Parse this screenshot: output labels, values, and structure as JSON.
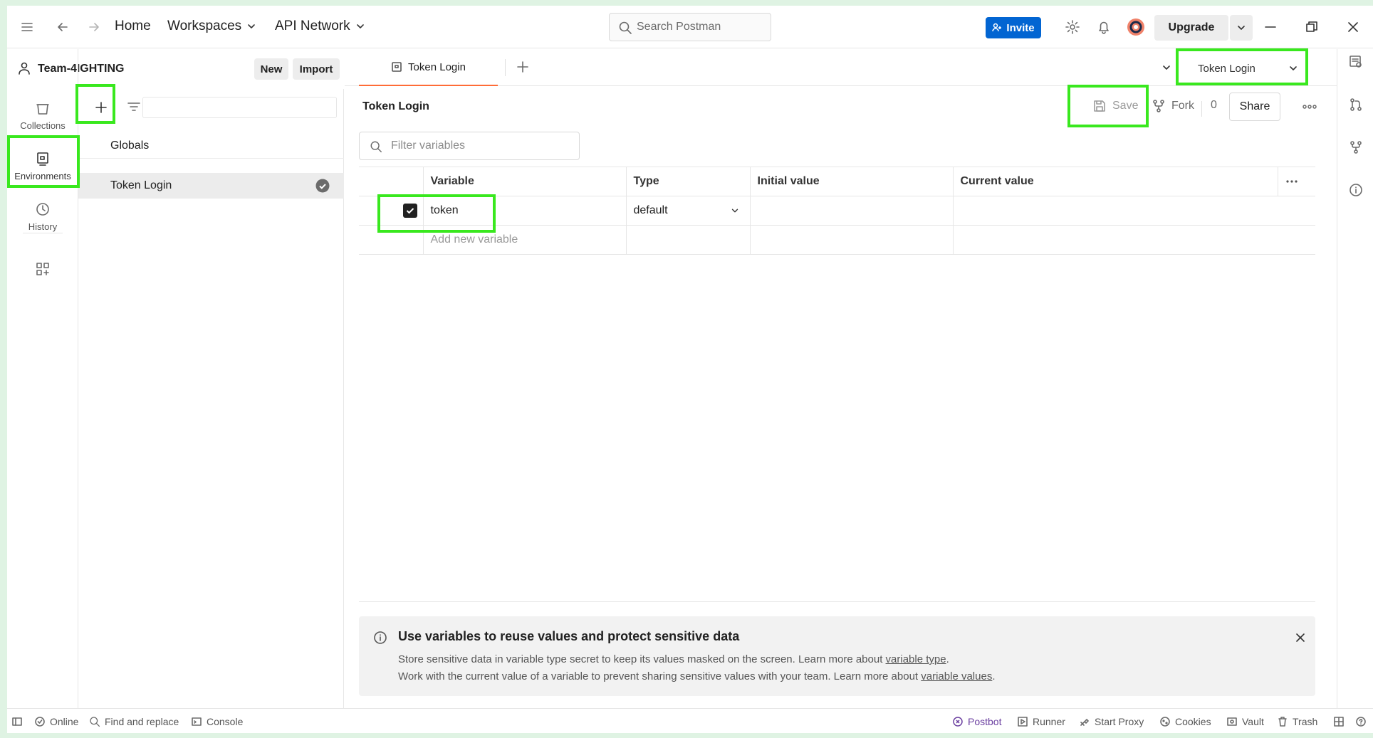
{
  "topbar": {
    "home": "Home",
    "workspaces": "Workspaces",
    "api_network": "API Network",
    "search_placeholder": "Search Postman",
    "invite": "Invite",
    "upgrade": "Upgrade"
  },
  "rail": {
    "collections": "Collections",
    "environments": "Environments",
    "history": "History"
  },
  "sidebar": {
    "team_name": "Team-4IGHTING",
    "new_label": "New",
    "import_label": "Import",
    "items": [
      {
        "label": "Globals"
      },
      {
        "label": "Token Login",
        "active": true
      }
    ]
  },
  "tabs": {
    "active_tab": "Token Login",
    "environment_selected": "Token Login"
  },
  "editor": {
    "title": "Token Login",
    "save": "Save",
    "fork": "Fork",
    "fork_count": "0",
    "share": "Share",
    "filter_placeholder": "Filter variables",
    "columns": {
      "variable": "Variable",
      "type": "Type",
      "initial": "Initial value",
      "current": "Current value"
    },
    "rows": [
      {
        "variable": "token",
        "type": "default",
        "initial": "",
        "current": "",
        "checked": true
      }
    ],
    "add_placeholder": "Add new variable"
  },
  "info": {
    "title": "Use variables to reuse values and protect sensitive data",
    "line1_text": "Store sensitive data in variable type secret to keep its values masked on the screen. Learn more about ",
    "line1_link": "variable type",
    "line2_text": "Work with the current value of a variable to prevent sharing sensitive values with your team. Learn more about ",
    "line2_link": "variable values"
  },
  "statusbar": {
    "online": "Online",
    "find_replace": "Find and replace",
    "console": "Console",
    "postbot": "Postbot",
    "runner": "Runner",
    "start_proxy": "Start Proxy",
    "cookies": "Cookies",
    "vault": "Vault",
    "trash": "Trash"
  },
  "colors": {
    "accent": "#ff6c37",
    "invite_blue": "#0265d2",
    "highlight_green": "#39e81e",
    "postbot_purple": "#6b3fa0"
  }
}
